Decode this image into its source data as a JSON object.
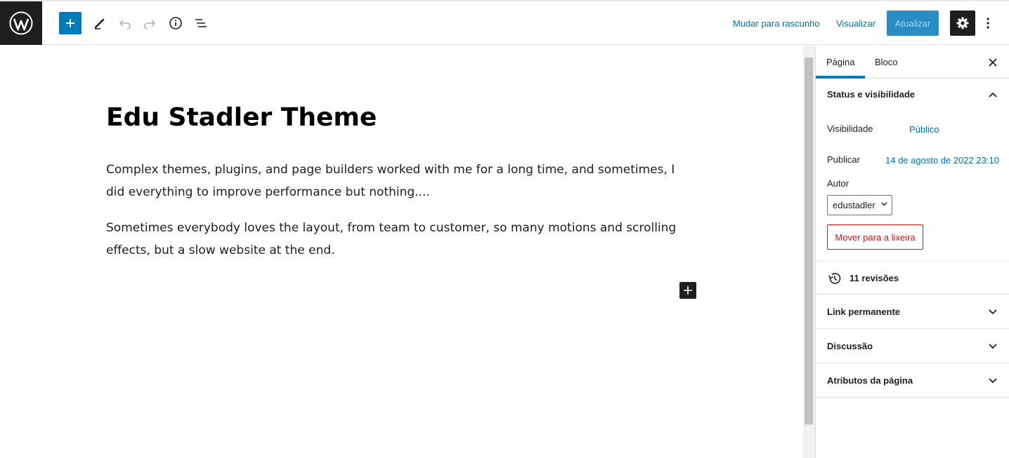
{
  "toolbar": {
    "switch_to_draft": "Mudar para rascunho",
    "preview": "Visualizar",
    "update": "Atualizar"
  },
  "editor": {
    "title": "Edu Stadler Theme",
    "paragraphs": [
      "Complex themes, plugins, and page builders worked with me for a long time, and sometimes, I did everything to improve performance but nothing....",
      "Sometimes everybody loves the layout, from team to customer, so many motions and scrolling effects, but a slow website at the end."
    ]
  },
  "sidebar": {
    "tabs": [
      "Página",
      "Bloco"
    ],
    "status": {
      "title": "Status e visibilidade",
      "visibility_label": "Visibilidade",
      "visibility_value": "Público",
      "publish_label": "Publicar",
      "publish_value": "14 de agosto de 2022 23:10",
      "author_label": "Autor",
      "author_value": "edustadler",
      "trash_label": "Mover para a lixeira"
    },
    "revisions": "11 revisões",
    "panels": [
      "Link permanente",
      "Discussão",
      "Atributos da página"
    ]
  },
  "colors": {
    "accent": "#007cba",
    "dark": "#1e1e1e",
    "danger": "#cc1818"
  }
}
